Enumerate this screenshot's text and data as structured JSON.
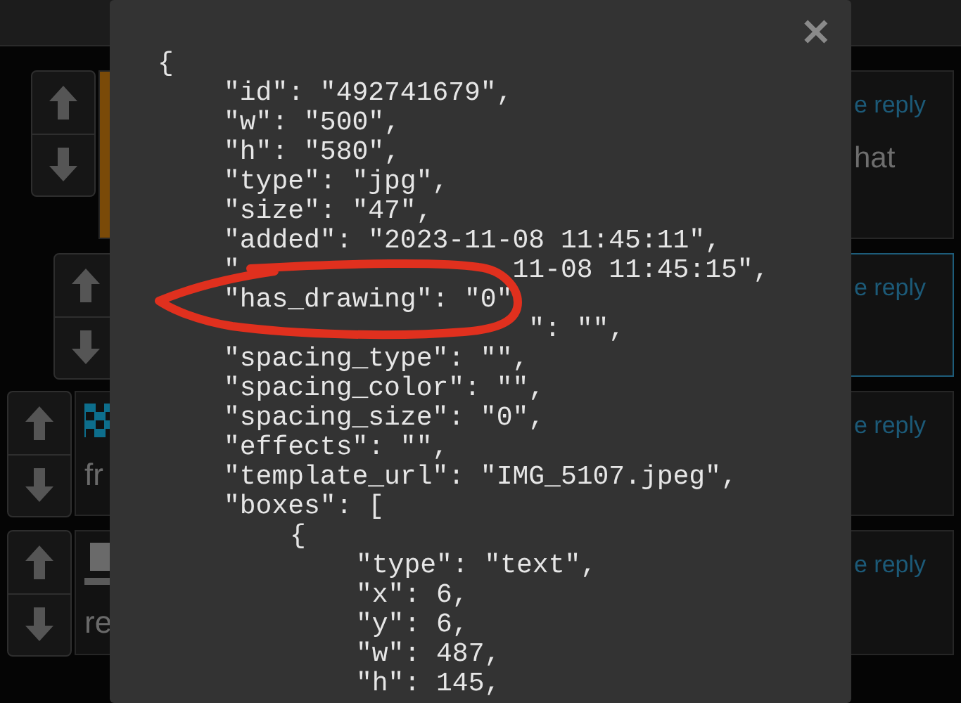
{
  "comments": [
    {
      "kind": "strip",
      "reply_link": "e reply",
      "text": "hat",
      "highlighted": false
    },
    {
      "kind": "plain",
      "reply_link": "e reply",
      "highlighted": true
    },
    {
      "kind": "checker",
      "snippet": "fr",
      "reply_link": "e reply",
      "highlighted": false
    },
    {
      "kind": "picture",
      "snippet": "re",
      "reply_link": "e reply",
      "highlighted": false
    }
  ],
  "modal": {
    "lines": [
      {
        "text": "{",
        "children": [
          {
            "text": "\"id\": \"492741679\","
          },
          {
            "text": "\"w\": \"500\","
          },
          {
            "text": "\"h\": \"580\","
          },
          {
            "text": "\"type\": \"jpg\","
          },
          {
            "text": "\"size\": \"47\","
          },
          {
            "text": "\"added\": \"2023-11-08 11:45:11\","
          },
          {
            "text": "\"                 11-08 11:45:15\","
          },
          {
            "text": "\"has_drawing\": \"0\""
          },
          {
            "text": "                   \": \"\","
          },
          {
            "text": "\"spacing_type\": \"\","
          },
          {
            "text": "\"spacing_color\": \"\","
          },
          {
            "text": "\"spacing_size\": \"0\","
          },
          {
            "text": "\"effects\": \"\","
          },
          {
            "text": "\"template_url\": \"IMG_5107.jpeg\","
          },
          {
            "text": "\"boxes\": [",
            "children": [
              {
                "text": "{",
                "children": [
                  {
                    "text": "\"type\": \"text\","
                  },
                  {
                    "text": "\"x\": 6,"
                  },
                  {
                    "text": "\"y\": 6,"
                  },
                  {
                    "text": "\"w\": 487,"
                  },
                  {
                    "text": "\"h\": 145,"
                  }
                ]
              }
            ]
          }
        ]
      }
    ],
    "close": "✕"
  }
}
